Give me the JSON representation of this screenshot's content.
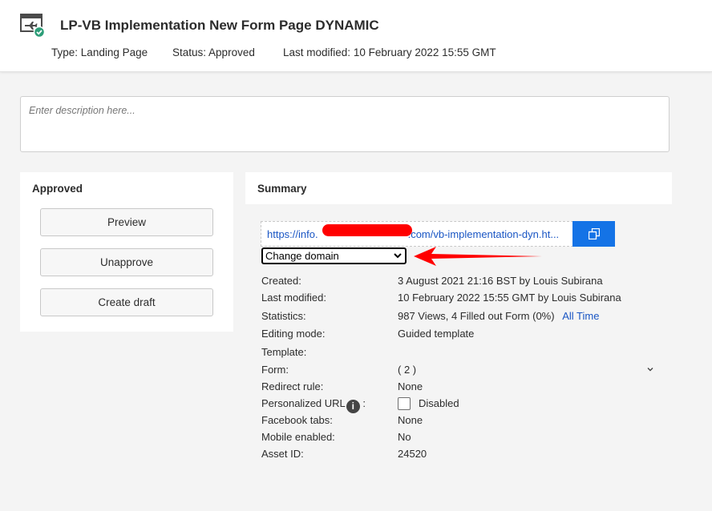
{
  "header": {
    "icon": "landing-page-approved-icon",
    "title": "LP-VB Implementation New Form Page DYNAMIC",
    "type_label": "Type:",
    "type_value": "Landing Page",
    "status_label": "Status:",
    "status_value": "Approved",
    "modified_label": "Last modified:",
    "modified_value": "10 February 2022 15:55 GMT"
  },
  "description": {
    "placeholder": "Enter description here..."
  },
  "left_panel": {
    "title": "Approved",
    "buttons": [
      "Preview",
      "Unapprove",
      "Create draft"
    ]
  },
  "summary": {
    "title": "Summary",
    "url_prefix": "https://info.",
    "url_suffix": ".com/vb-implementation-dyn.ht...",
    "copy_icon": "copy-icon",
    "domain_select": "Change domain",
    "rows": {
      "created_label": "Created:",
      "created_value": "3 August 2021 21:16 BST by Louis Subirana",
      "modified_label": "Last modified:",
      "modified_value": "10 February 2022 15:55 GMT by Louis Subirana",
      "stats_label": "Statistics:",
      "stats_value": "987 Views, 4 Filled out Form (0%)",
      "stats_link": "All Time",
      "editing_label": "Editing mode:",
      "editing_value": "Guided template",
      "template_label": "Template:",
      "form_label": "Form:",
      "form_value": "( 2 )",
      "redirect_label": "Redirect rule:",
      "redirect_value": "None",
      "purl_label": "Personalized URL",
      "purl_colon": ":",
      "purl_value": "Disabled",
      "facebook_label": "Facebook tabs:",
      "facebook_value": "None",
      "mobile_label": "Mobile enabled:",
      "mobile_value": "No",
      "asset_label": "Asset ID:",
      "asset_value": "24520"
    }
  },
  "colors": {
    "accent": "#1473e6",
    "link": "#1a56c4",
    "annotation_red": "#ff0000",
    "approved_green": "#2d9d78"
  }
}
